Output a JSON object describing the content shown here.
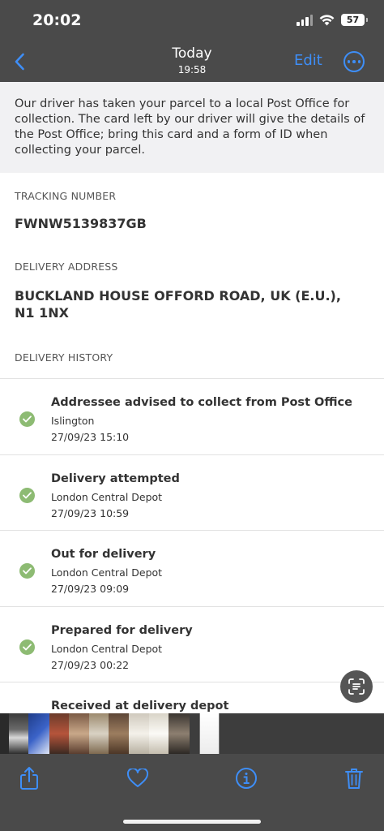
{
  "status_bar": {
    "time": "20:02",
    "battery": "57"
  },
  "nav": {
    "title": "Today",
    "subtitle": "19:58",
    "edit_label": "Edit"
  },
  "notice": "Our driver has taken your parcel to a local Post Office for collection. The card left by our driver will give the details of the Post Office; bring this card and a form of ID when collecting your parcel.",
  "tracking": {
    "label": "TRACKING NUMBER",
    "value": "FWNW5139837GB"
  },
  "address": {
    "label": "DELIVERY ADDRESS",
    "value": "BUCKLAND HOUSE OFFORD ROAD, UK (E.U.), N1 1NX"
  },
  "history": {
    "label": "DELIVERY HISTORY",
    "items": [
      {
        "title": "Addressee advised to collect from Post Office",
        "location": "Islington",
        "time": "27/09/23 15:10"
      },
      {
        "title": "Delivery attempted",
        "location": "London Central Depot",
        "time": "27/09/23 10:59"
      },
      {
        "title": "Out for delivery",
        "location": "London Central Depot",
        "time": "27/09/23 09:09"
      },
      {
        "title": "Prepared for delivery",
        "location": "London Central Depot",
        "time": "27/09/23 00:22"
      },
      {
        "title": "Received at delivery depot",
        "location": "",
        "time": ""
      }
    ]
  },
  "colors": {
    "accent": "#3e8ef7",
    "check": "#8dbb73",
    "notice_bg": "#f1f1f3"
  },
  "icons": {
    "back": "chevron-left-icon",
    "more": "ellipsis-circle-icon",
    "scan": "live-text-icon",
    "share": "share-icon",
    "favorite": "heart-icon",
    "info": "info-icon",
    "delete": "trash-icon"
  }
}
